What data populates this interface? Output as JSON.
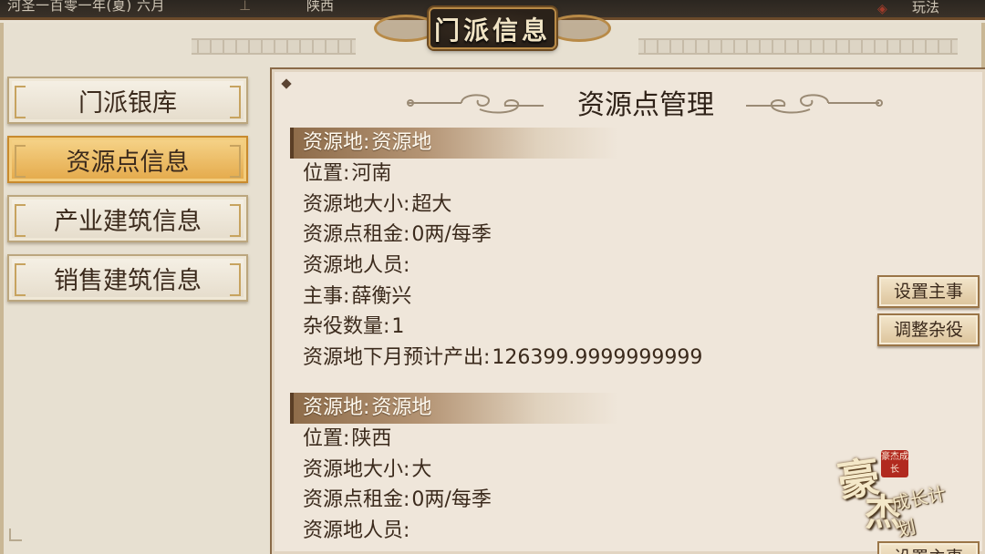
{
  "topbar": {
    "date": "河圣一百零一年(夏) 六月",
    "region": "陕西",
    "right_label": "玩法"
  },
  "banner": {
    "title": "门派信息"
  },
  "nav": {
    "items": [
      {
        "label": "门派银库",
        "active": false
      },
      {
        "label": "资源点信息",
        "active": true
      },
      {
        "label": "产业建筑信息",
        "active": false
      },
      {
        "label": "销售建筑信息",
        "active": false
      }
    ]
  },
  "panel": {
    "title": "资源点管理",
    "sections": [
      {
        "header_key": "资源地:",
        "header_value": "资源地",
        "rows": [
          {
            "key": "位置:",
            "value": "河南"
          },
          {
            "key": "资源地大小:",
            "value": "超大"
          },
          {
            "key": "资源点租金:",
            "value": "0两/每季"
          },
          {
            "key": "资源地人员:",
            "value": ""
          },
          {
            "key": "主事:",
            "value": "薛衡兴"
          },
          {
            "key": "杂役数量:",
            "value": "1"
          },
          {
            "key": "资源地下月预计产出:",
            "value": "126399.9999999999"
          }
        ]
      },
      {
        "header_key": "资源地:",
        "header_value": "资源地",
        "rows": [
          {
            "key": "位置:",
            "value": "陕西"
          },
          {
            "key": "资源地大小:",
            "value": "大"
          },
          {
            "key": "资源点租金:",
            "value": "0两/每季"
          },
          {
            "key": "资源地人员:",
            "value": ""
          }
        ]
      }
    ]
  },
  "actions": {
    "set_manager": "设置主事",
    "adjust_workers": "调整杂役",
    "set_manager_2": "设置主事"
  },
  "logo": {
    "char1": "豪",
    "char2": "杰",
    "small": "成长计划",
    "seal": "豪杰成长"
  },
  "colors": {
    "accent_gold": "#e4a94a",
    "panel_bg": "#efe6da",
    "header_brown": "#8e6c4a",
    "text_dark": "#3b2a1c",
    "seal_red": "#b12a1f"
  }
}
